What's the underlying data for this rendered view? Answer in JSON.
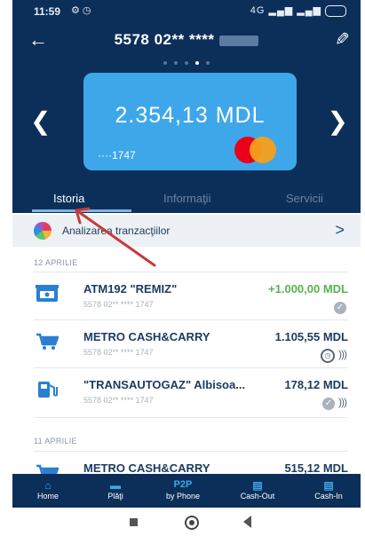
{
  "status_bar": {
    "time": "11:59",
    "signal": "4G"
  },
  "header": {
    "card_title": "5578 02** ****",
    "back_icon": "back-arrow-icon",
    "edit_icon": "edit-pencil-icon"
  },
  "card": {
    "balance": "2.354,13 MDL",
    "last_digits": "····1747",
    "brand": "mastercard",
    "color": "#3ea7ea"
  },
  "carousel": {
    "dots": 5,
    "active": 3
  },
  "tabs": [
    {
      "label": "Istoria"
    },
    {
      "label": "Informaţii"
    },
    {
      "label": "Servicii"
    }
  ],
  "analysis": {
    "label": "Analizarea tranzacţiilor"
  },
  "groups": [
    {
      "date": "12 APRILIE",
      "items": [
        {
          "merchant": "ATM192 \"REMIZ\"",
          "card": "5578 02** **** 1747",
          "amount": "+1.000,00 MDL",
          "icon": "atm-icon"
        },
        {
          "merchant": "METRO CASH&CARRY",
          "card": "5578 02** **** 1747",
          "amount": "1.105,55 MDL",
          "icon": "shopping-cart-icon"
        },
        {
          "merchant": "\"TRANSAUTOGAZ\" Albisoa...",
          "card": "5578 02** **** 1747",
          "amount": "178,12 MDL",
          "icon": "fuel-pump-icon"
        }
      ]
    },
    {
      "date": "11 APRILIE",
      "items": [
        {
          "merchant": "METRO CASH&CARRY",
          "amount": "515,12 MDL",
          "icon": "shopping-cart-icon"
        }
      ]
    }
  ],
  "bottom_nav": {
    "home": {
      "label": "Home"
    },
    "plati": {
      "label": "Plăţi"
    },
    "p2p": {
      "icon_text": "P2P",
      "label": "by Phone"
    },
    "cashout": {
      "label": "Cash-Out"
    },
    "cashin": {
      "label": "Cash-In"
    }
  },
  "colors": {
    "header_bg": "#0c2f5a",
    "accent": "#3ea7ea",
    "positive": "#55b44c",
    "annotation_arrow": "#c83a3a"
  }
}
